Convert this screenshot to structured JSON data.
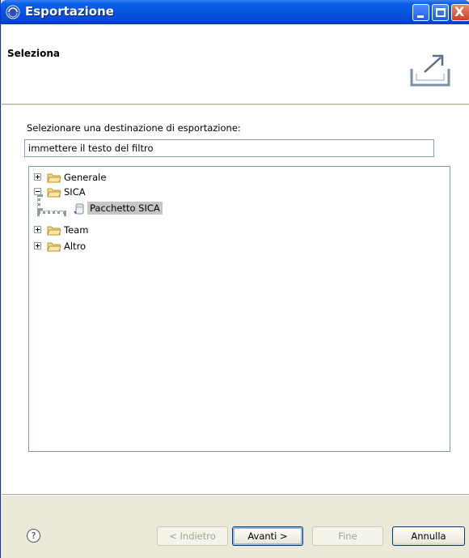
{
  "window": {
    "title": "Esportazione",
    "controls": {
      "minimize": "minimize",
      "maximize": "maximize",
      "close": "X"
    }
  },
  "banner": {
    "title": "Seleziona",
    "icon": "export-icon"
  },
  "main": {
    "destination_label": "Selezionare una destinazione di esportazione:",
    "filter": {
      "value": "immettere il testo del filtro"
    },
    "tree": [
      {
        "label": "Generale",
        "expanded": false,
        "icon": "folder-icon"
      },
      {
        "label": "SICA",
        "expanded": true,
        "icon": "folder-icon",
        "children": [
          {
            "label": "Pacchetto SICA",
            "selected": true,
            "icon": "package-icon"
          }
        ]
      },
      {
        "label": "Team",
        "expanded": false,
        "icon": "folder-icon"
      },
      {
        "label": "Altro",
        "expanded": false,
        "icon": "folder-icon"
      }
    ]
  },
  "footer": {
    "help": "?",
    "back_label": "< Indietro",
    "next_label": "Avanti >",
    "finish_label": "Fine",
    "cancel_label": "Annulla"
  },
  "colors": {
    "titlebar": "#0655e0",
    "dialog_bg": "#ece9d8",
    "selection": "#c6c6c6",
    "folder": "#e8c460"
  }
}
